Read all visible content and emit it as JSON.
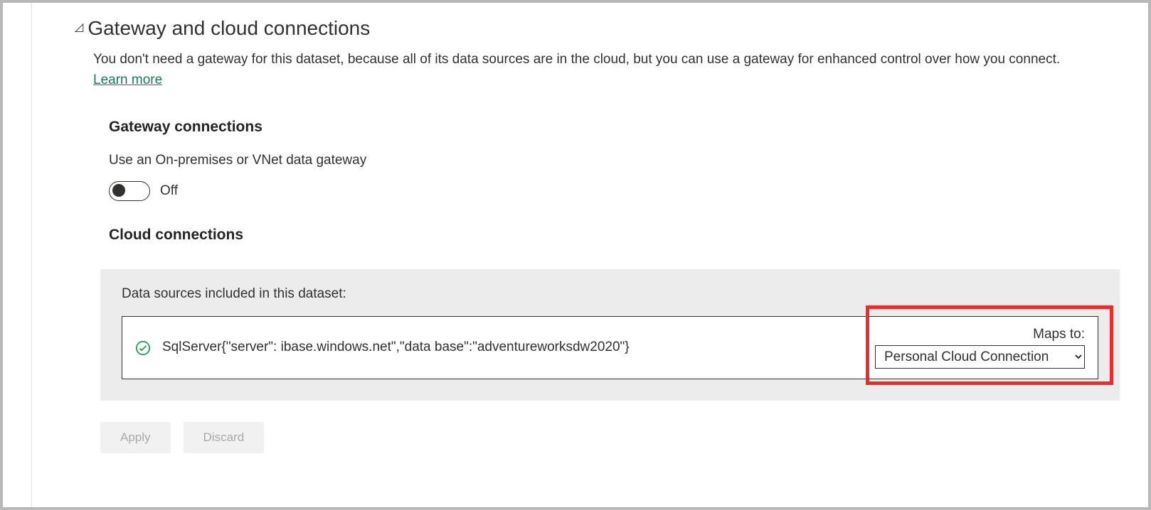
{
  "section": {
    "title": "Gateway and cloud connections",
    "description_pre": "You don't need a gateway for this dataset, because all of its data sources are in the cloud, but you can use a gateway for enhanced control over how you connect. ",
    "learn_more": "Learn more"
  },
  "gateway": {
    "heading": "Gateway connections",
    "toggle_label": "Use an On-premises or VNet data gateway",
    "toggle_state": "Off"
  },
  "cloud": {
    "heading": "Cloud connections",
    "panel_label": "Data sources included in this dataset:",
    "source_text": "SqlServer{\"server\":                           ibase.windows.net\",\"data base\":\"adventureworksdw2020\"}",
    "maps_label": "Maps to:",
    "maps_selected": "Personal Cloud Connection"
  },
  "actions": {
    "apply": "Apply",
    "discard": "Discard"
  }
}
